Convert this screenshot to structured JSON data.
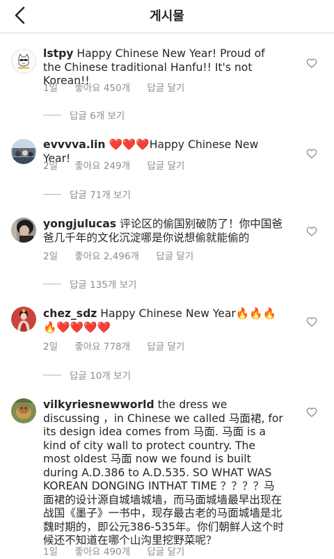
{
  "header": {
    "title": "게시물"
  },
  "colors": {
    "text": "#262626",
    "meta": "#8e8e8e",
    "heart": "#ed2e2e"
  },
  "comments": [
    {
      "username": "lstpy",
      "text": "Happy Chinese New Year! Proud of the Chinese traditional Hanfu!! It's not Korean!!",
      "time": "1일",
      "likes": "좋아요 450개",
      "reply": "답글 달기",
      "view_replies": "답글 6개 보기"
    },
    {
      "username": "evvvva.lin",
      "emoji": "❤️❤️❤️",
      "text": "Happy Chinese New Year!",
      "time": "2일",
      "likes": "좋아요 249개",
      "reply": "답글 달기",
      "view_replies": "답글 71개 보기"
    },
    {
      "username": "yongjulucas",
      "text": "评论区的偷国别破防了！你中国爸爸几千年的文化沉淀哪是你说想偷就能偷的",
      "time": "2일",
      "likes": "좋아요 2,496개",
      "reply": "답글 달기",
      "view_replies": "답글 135개 보기"
    },
    {
      "username": "chez_sdz",
      "text": "Happy Chinese New Year",
      "emoji": "🔥🔥🔥🔥❤️❤️❤️❤️",
      "time": "2일",
      "likes": "좋아요 778개",
      "reply": "답글 달기",
      "view_replies": "답글 10개 보기"
    },
    {
      "username": "vilkyriesnewworld",
      "text": "the dress we discussing ，in Chinese we called 马面裙, for its design idea comes from 马面. 马面 is a kind of city wall to protect country. The most oldest 马面 now we found is built during A.D.386 to A.D.535. SO WHAT WAS KOREAN DONGING INTHAT TIME ？？？？马面裙的设计源自城墙城墙，而马面城墙最早出现在战国《墨子》一书中，现存最古老的马面城墙是北魏时期的，即公元386-535年。你们朝鲜人这个时候还不知道在哪个山沟里挖野菜呢？",
      "time": "1일",
      "likes": "좋아요 490개",
      "reply": "답글 달기"
    }
  ]
}
